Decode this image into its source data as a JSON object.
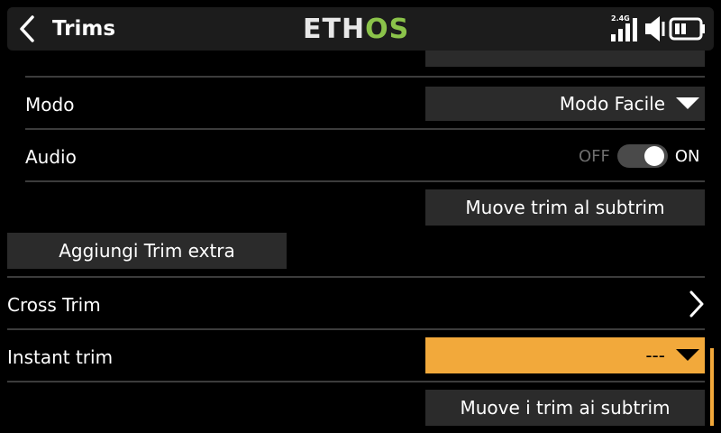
{
  "header": {
    "title": "Trims",
    "logo_part1": "ETH",
    "logo_part2": "OS",
    "logo_color_main": "#e8e8e8",
    "logo_color_accent": "#8bc34a",
    "signal_label": "2.4G",
    "icons": [
      "back-icon",
      "signal-icon",
      "volume-icon",
      "battery-icon"
    ]
  },
  "rows": {
    "modo": {
      "label": "Modo",
      "value": "Modo Facile"
    },
    "audio": {
      "label": "Audio",
      "off": "OFF",
      "on": "ON",
      "state": "on"
    },
    "move_trim_subtrim": {
      "label": "Muove trim al subtrim"
    },
    "add_extra": {
      "label": "Aggiungi Trim extra"
    },
    "cross_trim": {
      "label": "Cross Trim"
    },
    "instant_trim": {
      "label": "Instant trim",
      "value": "---"
    },
    "move_trims_subtrims": {
      "label": "Muove i trim ai subtrim"
    }
  },
  "colors": {
    "accent": "#f2a93b",
    "field_bg": "#2b2b2b",
    "header_bg": "#1c1c1c"
  }
}
